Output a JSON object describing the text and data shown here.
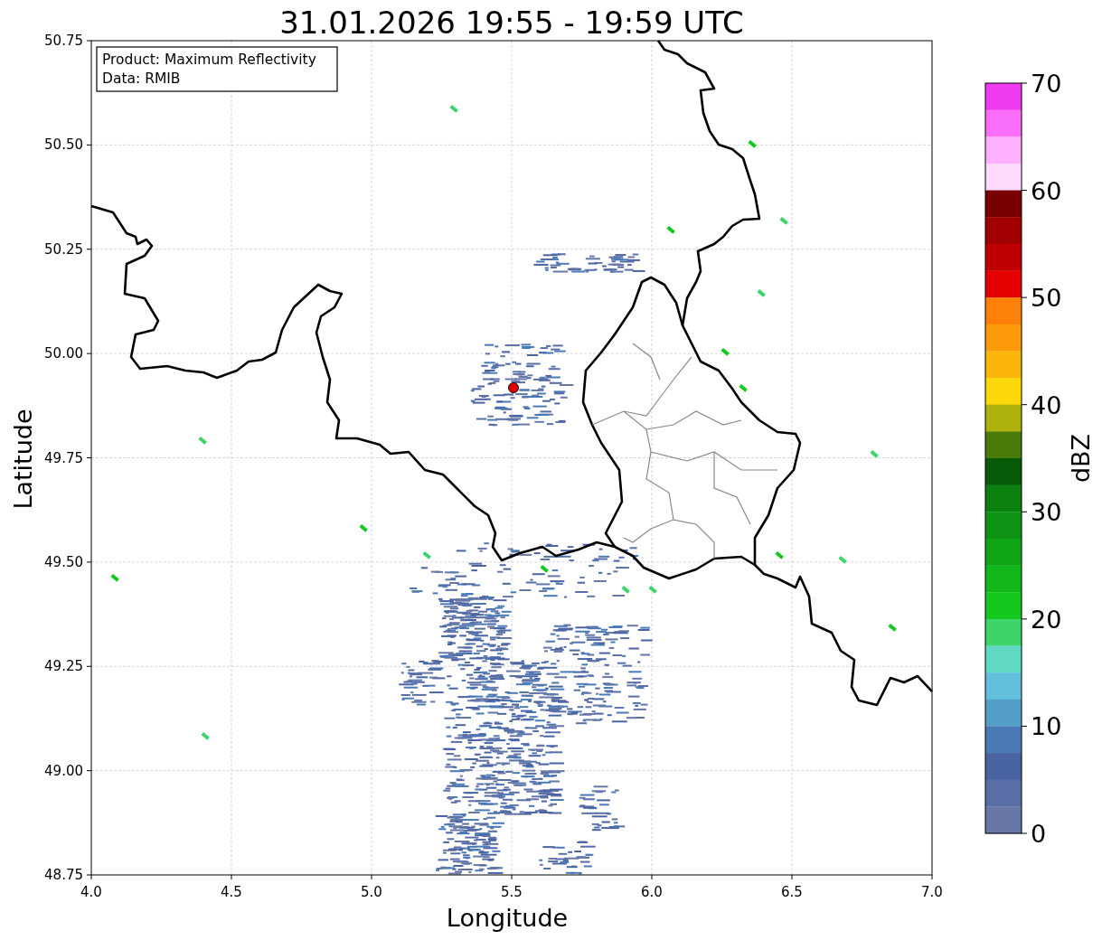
{
  "title": "31.01.2026 19:55 - 19:59 UTC",
  "legend": [
    "Product: Maximum Reflectivity",
    "Data: RMIB"
  ],
  "x_axis": {
    "label": "Longitude",
    "ticks": [
      "4.0",
      "4.5",
      "5.0",
      "5.5",
      "6.0",
      "6.5",
      "7.0"
    ]
  },
  "y_axis": {
    "label": "Latitude",
    "ticks": [
      "50.75",
      "50.50",
      "50.25",
      "50.00",
      "49.75",
      "49.50",
      "49.25",
      "49.00",
      "48.75"
    ]
  },
  "colorbar": {
    "label": "dBZ",
    "ticks": [
      "70",
      "60",
      "50",
      "40",
      "30",
      "20",
      "10",
      "0"
    ],
    "bins": [
      {
        "color": "#f03cf0"
      },
      {
        "color": "#fa6efa"
      },
      {
        "color": "#fdb0fd"
      },
      {
        "color": "#fdd9fd"
      },
      {
        "color": "#780000"
      },
      {
        "color": "#a00000"
      },
      {
        "color": "#c00000"
      },
      {
        "color": "#e60000"
      },
      {
        "color": "#fc800a"
      },
      {
        "color": "#fc9a0a"
      },
      {
        "color": "#fcb50a"
      },
      {
        "color": "#fcd80a"
      },
      {
        "color": "#adb10a"
      },
      {
        "color": "#4a7a0a"
      },
      {
        "color": "#065a08"
      },
      {
        "color": "#0b800f"
      },
      {
        "color": "#0e9414"
      },
      {
        "color": "#10a516"
      },
      {
        "color": "#12b81a"
      },
      {
        "color": "#14c81e"
      },
      {
        "color": "#3dd46a"
      },
      {
        "color": "#5fd8c4"
      },
      {
        "color": "#62c0dc"
      },
      {
        "color": "#529fc9"
      },
      {
        "color": "#4a7ab5"
      },
      {
        "color": "#4a63a3"
      },
      {
        "color": "#5a6ea6"
      },
      {
        "color": "#6677a8"
      }
    ]
  }
}
